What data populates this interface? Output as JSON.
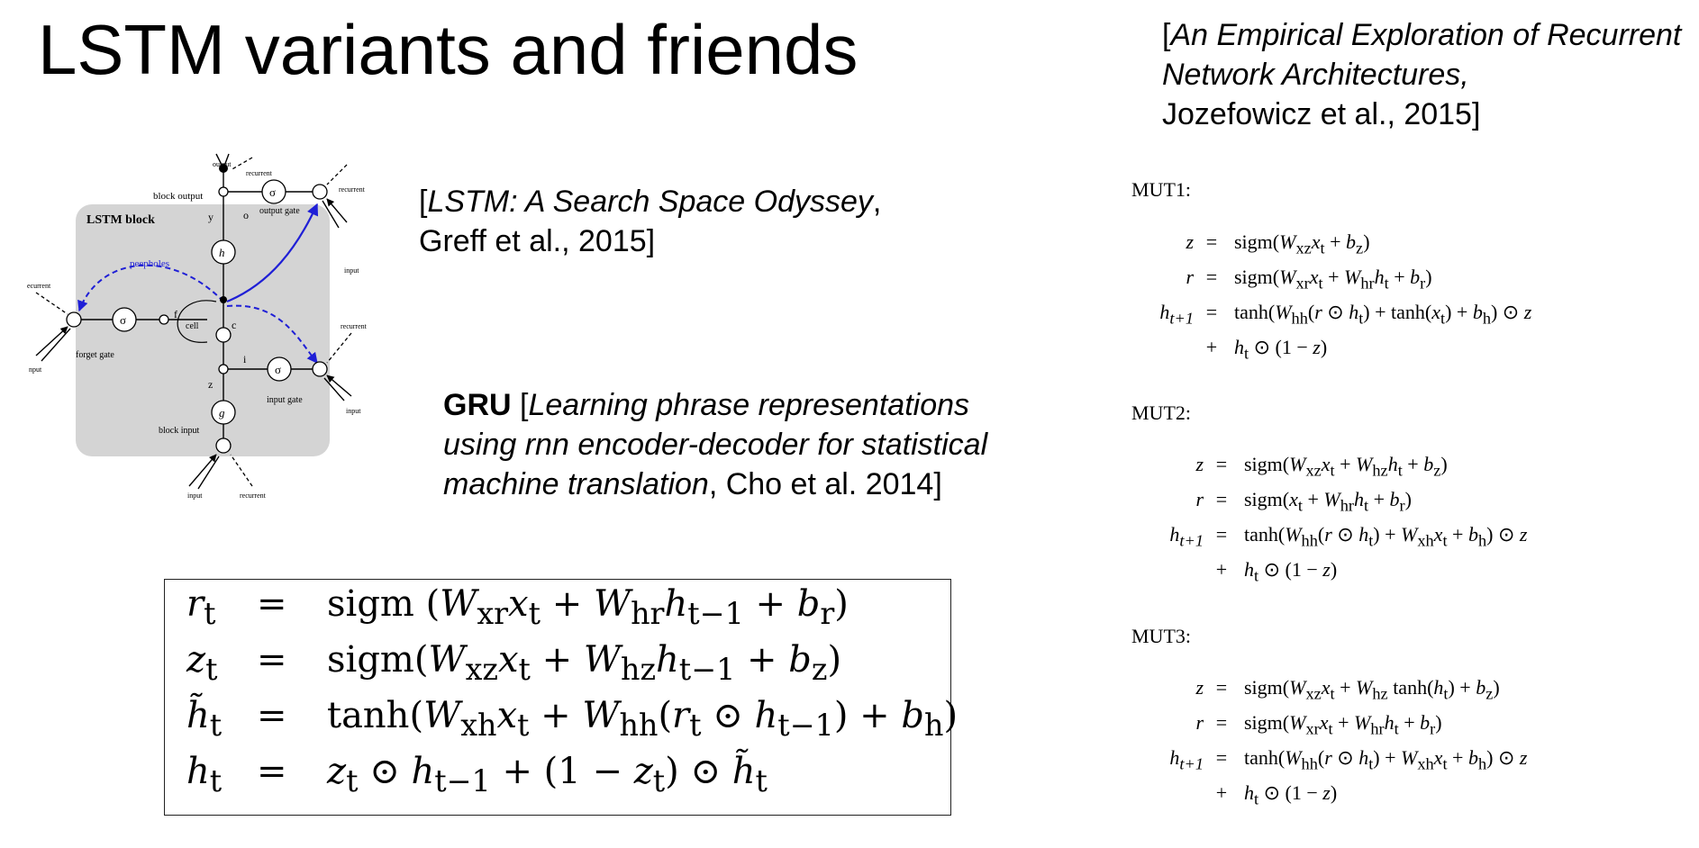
{
  "slide": {
    "title": "LSTM variants and friends"
  },
  "citations": {
    "greff": {
      "open": "[",
      "title": "LSTM: A Search Space Odyssey",
      "rest": ",",
      "authors": "Greff et al., 2015]"
    },
    "gru": {
      "label": "GRU",
      "open": " [",
      "title": "Learning phrase representations using rnn encoder-decoder for statistical machine translation",
      "rest": ", Cho et al. 2014]"
    },
    "jozefowicz": {
      "open": "[",
      "title": "An Empirical Exploration of Recurrent Network Architectures,",
      "authors": "Jozefowicz et al., 2015]"
    }
  },
  "diagram": {
    "title": "LSTM block",
    "labels": {
      "output": "output",
      "recurrent": "recurrent",
      "block_output": "block output",
      "output_gate": "output gate",
      "peepholes": "peepholes",
      "cell": "cell",
      "forget_gate": "forget gate",
      "input_gate": "input gate",
      "block_input": "block input",
      "input": "input",
      "recurrent_left": "ecurrent",
      "input_left": "nput",
      "y": "y",
      "o": "o",
      "f": "f",
      "c": "c",
      "i": "i",
      "z": "z",
      "h": "h",
      "g": "g",
      "sigma": "σ"
    },
    "colors": {
      "block_fill": "#d4d4d4",
      "peephole": "#1f1fd6"
    }
  },
  "gru_equations": [
    {
      "lhs": "r_t",
      "op": "=",
      "rhs": "sigm (W_xr x_t + W_hr h_{t−1} + b_r)"
    },
    {
      "lhs": "z_t",
      "op": "=",
      "rhs": "sigm(W_xz x_t + W_hz h_{t−1} + b_z)"
    },
    {
      "lhs": "h̃_t",
      "op": "=",
      "rhs": "tanh(W_xh x_t + W_hh(r_t ⊙ h_{t−1}) + b_h)"
    },
    {
      "lhs": "h_t",
      "op": "=",
      "rhs": "z_t ⊙ h_{t−1} + (1 − z_t) ⊙ h̃_t"
    }
  ],
  "mut": [
    {
      "label": "MUT1:",
      "rows": [
        {
          "lhs": "z",
          "op": "=",
          "rhs": "sigm(W_xz x_t + b_z)"
        },
        {
          "lhs": "r",
          "op": "=",
          "rhs": "sigm(W_xr x_t + W_hr h_t + b_r)"
        },
        {
          "lhs": "h_{t+1}",
          "op": "=",
          "rhs": "tanh(W_hh(r ⊙ h_t) + tanh(x_t) + b_h) ⊙ z"
        },
        {
          "lhs": "",
          "op": "+",
          "rhs": "h_t ⊙ (1 − z)"
        }
      ]
    },
    {
      "label": "MUT2:",
      "rows": [
        {
          "lhs": "z",
          "op": "=",
          "rhs": "sigm(W_xz x_t + W_hz h_t + b_z)"
        },
        {
          "lhs": "r",
          "op": "=",
          "rhs": "sigm(x_t + W_hr h_t + b_r)"
        },
        {
          "lhs": "h_{t+1}",
          "op": "=",
          "rhs": "tanh(W_hh(r ⊙ h_t) + W_xh x_t + b_h) ⊙ z"
        },
        {
          "lhs": "",
          "op": "+",
          "rhs": "h_t ⊙ (1 − z)"
        }
      ]
    },
    {
      "label": "MUT3:",
      "rows": [
        {
          "lhs": "z",
          "op": "=",
          "rhs": "sigm(W_xz x_t + W_hz tanh(h_t) + b_z)"
        },
        {
          "lhs": "r",
          "op": "=",
          "rhs": "sigm(W_xr x_t + W_hr h_t + b_r)"
        },
        {
          "lhs": "h_{t+1}",
          "op": "=",
          "rhs": "tanh(W_hh(r ⊙ h_t) + W_xh x_t + b_h) ⊙ z"
        },
        {
          "lhs": "",
          "op": "+",
          "rhs": "h_t ⊙ (1 − z)"
        }
      ]
    }
  ]
}
